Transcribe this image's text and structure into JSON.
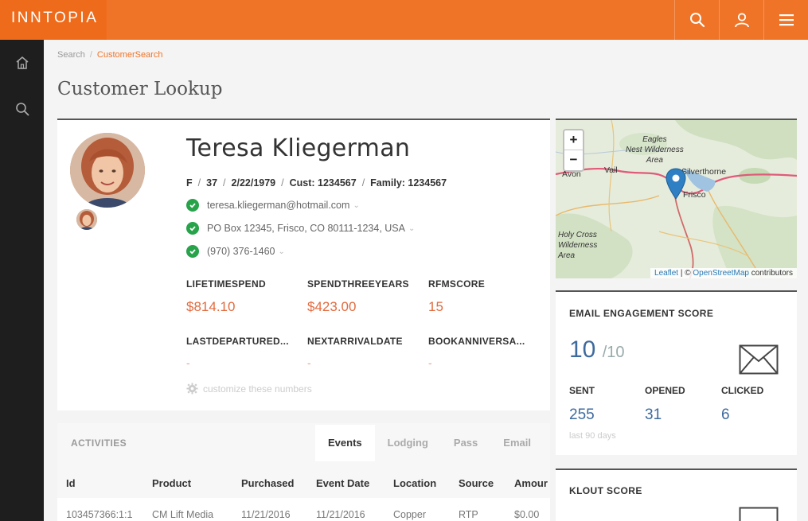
{
  "app": {
    "logo": "INNTOPIA"
  },
  "breadcrumb": {
    "items": [
      "Search",
      "CustomerSearch"
    ]
  },
  "page": {
    "title": "Customer Lookup"
  },
  "customer": {
    "name": "Teresa Kliegerman",
    "gender": "F",
    "age": "37",
    "dob": "2/22/1979",
    "cust": "Cust: 1234567",
    "family": "Family: 1234567",
    "email": "teresa.kliegerman@hotmail.com",
    "address": "PO Box 12345, Frisco, CO 80111-1234, USA",
    "phone": "(970) 376-1460"
  },
  "stats": [
    {
      "label": "LIFETIMESPEND",
      "value": "$814.10"
    },
    {
      "label": "SPENDTHREEYEARS",
      "value": "$423.00"
    },
    {
      "label": "RFMSCORE",
      "value": "15"
    },
    {
      "label": "LASTDEPARTURED...",
      "value": "-"
    },
    {
      "label": "NEXTARRIVALDATE",
      "value": "-"
    },
    {
      "label": "BOOKANNIVERSA...",
      "value": "-"
    }
  ],
  "customize_label": "customize these numbers",
  "map": {
    "zoom_in": "+",
    "zoom_out": "−",
    "labels": {
      "eagles": "Eagles\nNest Wilderness\nArea",
      "holy": "Holy Cross\nWilderness\nArea"
    },
    "towns": {
      "avon": "Avon",
      "vail": "Vail",
      "silverthorne": "Silverthorne",
      "frisco": "Frisco"
    },
    "attribution_leaflet": "Leaflet",
    "attribution_mid": " | © ",
    "attribution_osm": "OpenStreetMap",
    "attribution_end": " contributors"
  },
  "email_engagement": {
    "title": "EMAIL ENGAGEMENT SCORE",
    "score": "10",
    "denominator": "/10",
    "sent_label": "SENT",
    "sent": "255",
    "opened_label": "OPENED",
    "opened": "31",
    "clicked_label": "CLICKED",
    "clicked": "6",
    "note": "last 90 days"
  },
  "klout": {
    "title": "KLOUT SCORE"
  },
  "activities": {
    "title": "ACTIVITIES",
    "tabs": [
      "Events",
      "Lodging",
      "Pass",
      "Email"
    ],
    "columns": [
      "Id",
      "Product",
      "Purchased",
      "Event Date",
      "Location",
      "Source",
      "Amour"
    ],
    "rows": [
      [
        "103457366:1:1",
        "CM Lift Media",
        "11/21/2016",
        "11/21/2016",
        "Copper",
        "RTP",
        "$0.00"
      ]
    ]
  },
  "colors": {
    "brand": "#f07427",
    "sidebar": "#1e1e1e",
    "accent_value": "#e36b3f",
    "score_blue": "#3e6a9e",
    "check_green": "#27a34a"
  }
}
